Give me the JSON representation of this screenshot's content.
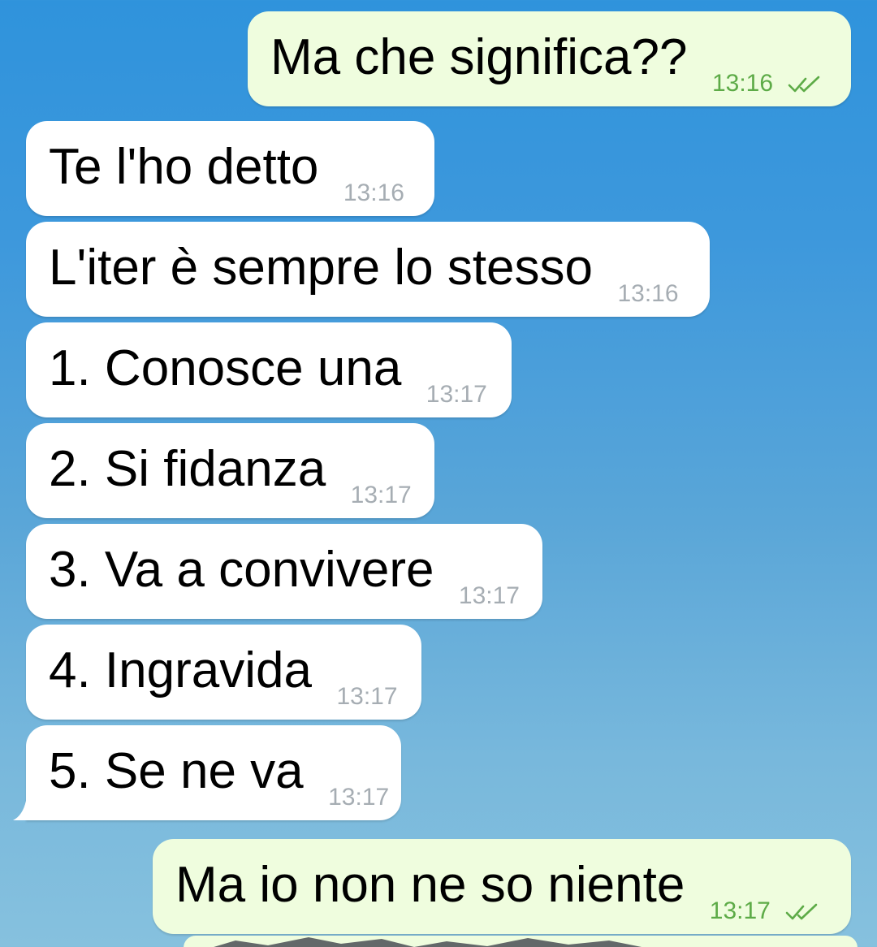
{
  "messages": [
    {
      "dir": "out",
      "text": "Ma che significa??",
      "time": "13:16",
      "status": "read-double-check"
    },
    {
      "dir": "in",
      "text": "Te l'ho detto",
      "time": "13:16"
    },
    {
      "dir": "in",
      "text": "L'iter è sempre lo stesso",
      "time": "13:16"
    },
    {
      "dir": "in",
      "text": "1. Conosce una",
      "time": "13:17"
    },
    {
      "dir": "in",
      "text": "2. Si fidanza",
      "time": "13:17"
    },
    {
      "dir": "in",
      "text": "3. Va a convivere",
      "time": "13:17"
    },
    {
      "dir": "in",
      "text": "4. Ingravida",
      "time": "13:17"
    },
    {
      "dir": "in",
      "text": "5. Se ne va",
      "time": "13:17"
    },
    {
      "dir": "out",
      "text": "Ma io non ne so niente",
      "time": "13:17",
      "status": "read-double-check"
    }
  ],
  "colors": {
    "incoming_bubble": "#ffffff",
    "outgoing_bubble": "#effdde",
    "incoming_time": "#a6adb3",
    "outgoing_time": "#5dab47",
    "check_color": "#5dab47",
    "background_top": "#2f93dc",
    "background_bottom": "#86c1de"
  }
}
